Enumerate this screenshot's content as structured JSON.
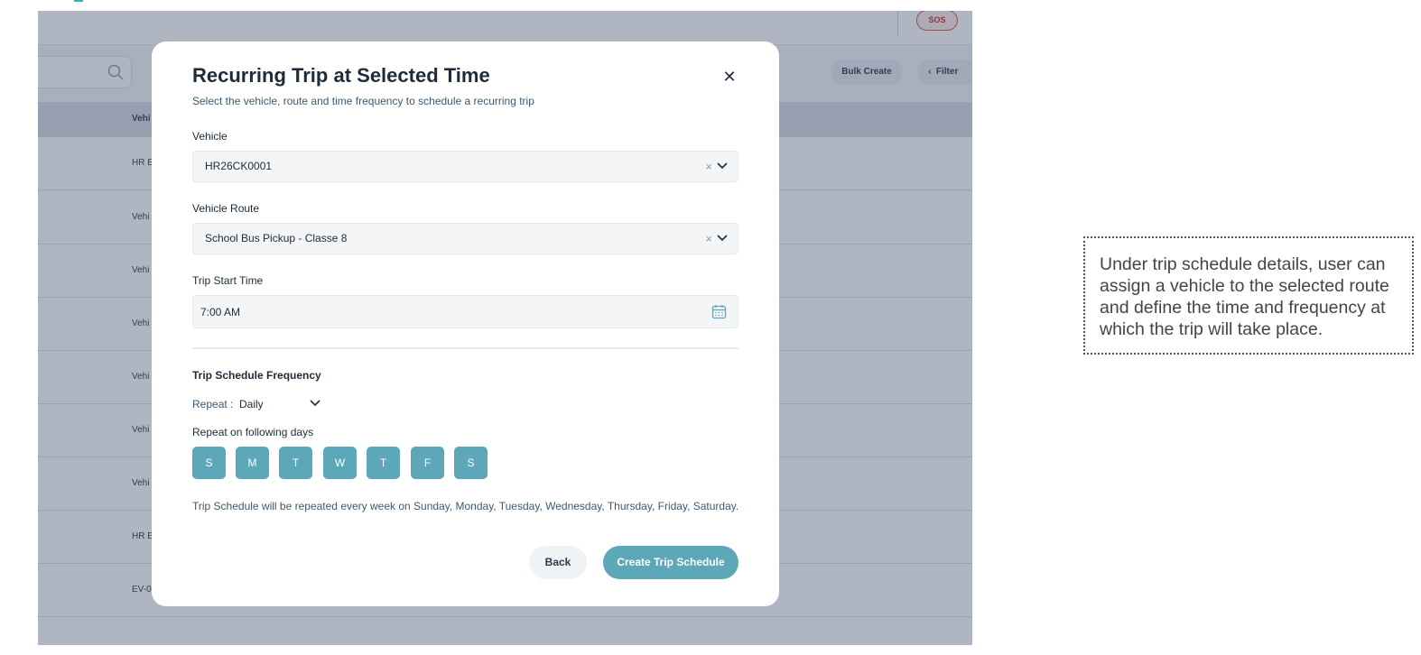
{
  "app": {
    "sos_label": "SOS",
    "bulk_create_label": "Bulk Create",
    "filter_label": "Filter",
    "table": {
      "header_first_col": "Vehi",
      "rows": [
        "HR E",
        "Vehi",
        "Vehi",
        "Vehi",
        "Vehi",
        "Vehi",
        "Vehi",
        "HR E",
        "EV-0"
      ]
    }
  },
  "modal": {
    "title": "Recurring Trip at Selected Time",
    "subtitle": "Select the vehicle, route and time frequency to schedule a recurring trip",
    "vehicle": {
      "label": "Vehicle",
      "value": "HR26CK0001"
    },
    "route": {
      "label": "Vehicle Route",
      "value": "School Bus Pickup - Classe 8"
    },
    "start_time": {
      "label": "Trip Start Time",
      "value": "7:00 AM"
    },
    "frequency": {
      "section_title": "Trip Schedule Frequency",
      "repeat_label": "Repeat :",
      "repeat_value": "Daily",
      "days_label": "Repeat on following days",
      "days": [
        "S",
        "M",
        "T",
        "W",
        "T",
        "F",
        "S"
      ],
      "summary": "Trip Schedule will be repeated every week on Sunday, Monday, Tuesday, Wednesday, Thursday, Friday, Saturday."
    },
    "back_label": "Back",
    "create_label": "Create Trip Schedule"
  },
  "annotation": {
    "text": "Under trip schedule details, user can assign a vehicle to the selected route and define the time and frequency at which the trip will take place."
  },
  "colors": {
    "accent": "#5ca8b8",
    "sos": "#d9534f",
    "overlay": "#364664"
  }
}
